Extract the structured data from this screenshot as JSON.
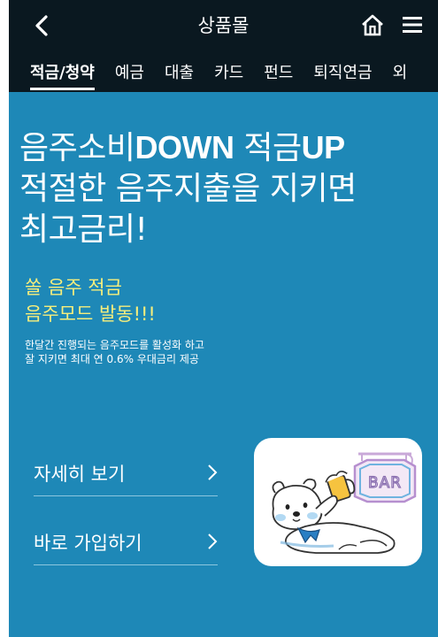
{
  "header": {
    "title": "상품몰",
    "back_icon": "chevron-left-icon",
    "home_icon": "home-icon",
    "menu_icon": "hamburger-menu-icon"
  },
  "tabs": [
    {
      "label": "적금/청약",
      "active": true
    },
    {
      "label": "예금"
    },
    {
      "label": "대출"
    },
    {
      "label": "카드"
    },
    {
      "label": "펀드"
    },
    {
      "label": "퇴직연금"
    },
    {
      "label": "외"
    }
  ],
  "banner": {
    "background": "#1e88b7",
    "headline": {
      "line1_a": "음주소비",
      "line1_b": "DOWN",
      "line1_c": " 적금",
      "line1_d": "UP",
      "line2": "적절한 음주지출을 지키면",
      "line3": "최고금리!"
    },
    "subhead": {
      "line1": "쏠 음주 적금",
      "line2": "음주모드 발동!!!",
      "color": "#f6ee7c"
    },
    "description": {
      "line1": "한달간 진행되는 음주모드를 활성화 하고",
      "line2": "잘 지키면 최대 연 0.6% 우대금리 제공"
    },
    "links": [
      {
        "label": "자세히 보기"
      },
      {
        "label": "바로 가입하기"
      }
    ],
    "illustration": {
      "sign_text": "BAR"
    }
  }
}
